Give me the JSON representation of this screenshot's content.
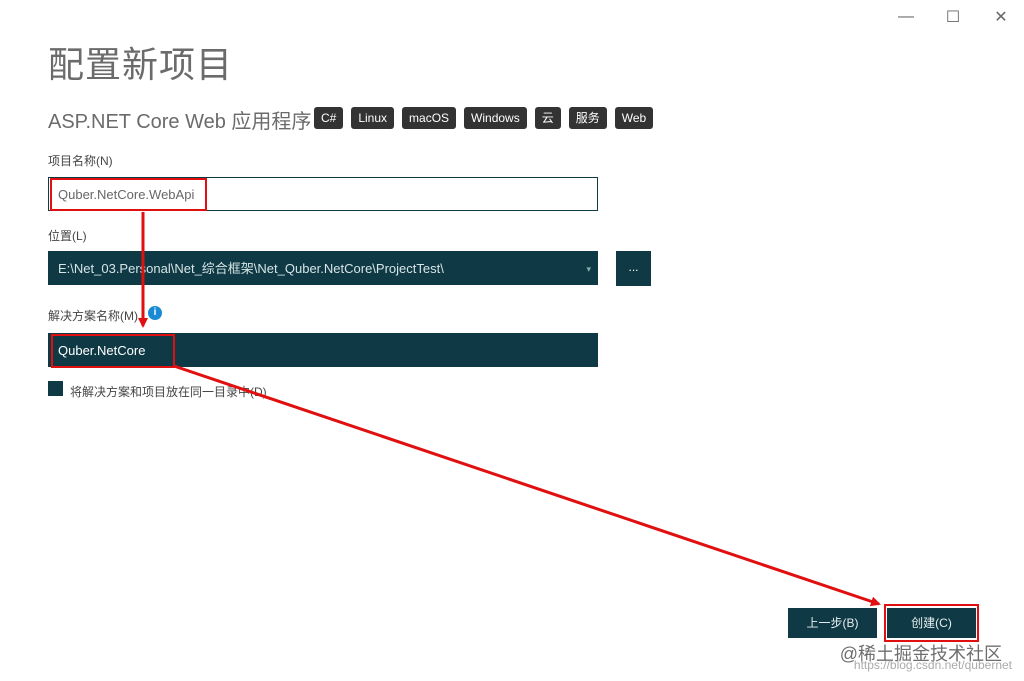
{
  "window": {
    "title": "配置新项目",
    "minimize_icon": "minimize-icon",
    "maximize_icon": "maximize-icon",
    "close_icon": "close-icon"
  },
  "template": {
    "name": "ASP.NET Core Web 应用程序",
    "tags": [
      "C#",
      "Linux",
      "macOS",
      "Windows",
      "云",
      "服务",
      "Web"
    ]
  },
  "project_name": {
    "label": "项目名称(N)",
    "value": "Quber.NetCore.WebApi"
  },
  "location": {
    "label": "位置(L)",
    "value": "E:\\Net_03.Personal\\Net_综合框架\\Net_Quber.NetCore\\ProjectTest\\",
    "browse_label": "..."
  },
  "solution_name": {
    "label": "解决方案名称(M)",
    "value": "Quber.NetCore",
    "info_icon": "info-icon"
  },
  "same_directory": {
    "label": "将解决方案和项目放在同一目录中(D)",
    "checked": false
  },
  "buttons": {
    "back": "上一步(B)",
    "create": "创建(C)"
  },
  "watermark": {
    "line1": "@稀土掘金技术社区",
    "line2": "https://blog.csdn.net/qubernet"
  },
  "colors": {
    "accent": "#0f3a45",
    "annotation": "#e01010"
  }
}
